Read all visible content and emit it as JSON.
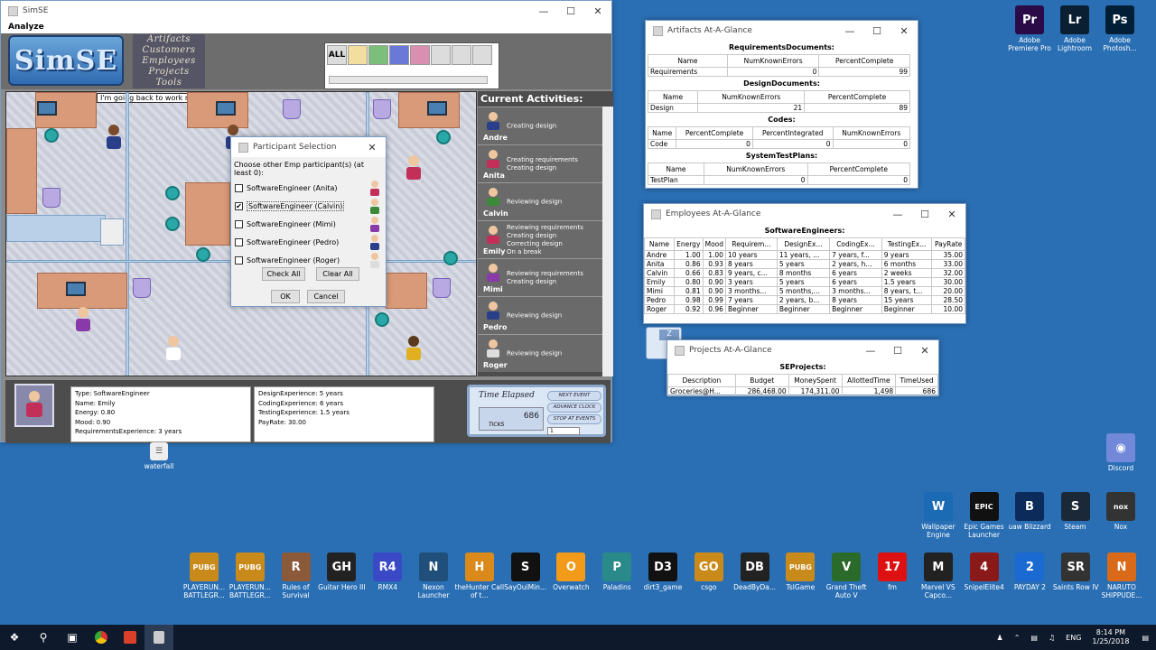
{
  "simse_window": {
    "title": "SimSE",
    "menu": "Analyze",
    "logo": "SimSE",
    "top_menu": [
      "Artifacts",
      "Customers",
      "Employees",
      "Projects",
      "Tools"
    ],
    "palette_all": "ALL",
    "speech_bubble": "I'm going back to work now",
    "activities_title": "Current Activities:",
    "activities": [
      {
        "name": "Andre",
        "lines": [
          "Creating design"
        ]
      },
      {
        "name": "Anita",
        "lines": [
          "Creating requirements",
          "Creating design"
        ]
      },
      {
        "name": "Calvin",
        "lines": [
          "Reviewing design"
        ]
      },
      {
        "name": "Emily",
        "lines": [
          "Reviewing requirements",
          "Creating design",
          "Correcting design",
          "On a break"
        ]
      },
      {
        "name": "Mimi",
        "lines": [
          "Reviewing requirements",
          "Creating design"
        ]
      },
      {
        "name": "Pedro",
        "lines": [
          "Reviewing design"
        ]
      },
      {
        "name": "Roger",
        "lines": [
          "Reviewing design"
        ]
      }
    ],
    "info_left": [
      "Type: SoftwareEngineer",
      "Name: Emily",
      "Energy: 0.80",
      "Mood: 0.90",
      "RequirementsExperience: 3 years"
    ],
    "info_right": [
      "DesignExperience: 5 years",
      "CodingExperience: 6 years",
      "TestingExperience: 1.5 years",
      "PayRate: 30.00"
    ],
    "timer": {
      "label": "Time Elapsed",
      "ticks_value": "686",
      "ticks_label": "TICKS",
      "next_event": "NEXT EVENT",
      "advance_clock": "ADVANCE CLOCK",
      "stop_at_events": "STOP AT EVENTS",
      "field_value": "1"
    }
  },
  "dialog": {
    "title": "Participant Selection",
    "prompt": "Choose other Emp participant(s) (at least 0):",
    "options": [
      {
        "label": "SoftwareEngineer (Anita)",
        "checked": false
      },
      {
        "label": "SoftwareEngineer (Calvin)",
        "checked": true
      },
      {
        "label": "SoftwareEngineer (Mimi)",
        "checked": false
      },
      {
        "label": "SoftwareEngineer (Pedro)",
        "checked": false
      },
      {
        "label": "SoftwareEngineer (Roger)",
        "checked": false
      }
    ],
    "check_all": "Check All",
    "clear_all": "Clear All",
    "ok": "OK",
    "cancel": "Cancel"
  },
  "artifacts_window": {
    "title": "Artifacts At-A-Glance",
    "sections": [
      {
        "title": "RequirementsDocuments:",
        "headers": [
          "Name",
          "NumKnownErrors",
          "PercentComplete"
        ],
        "rows": [
          [
            "Requirements",
            "0",
            "99"
          ]
        ]
      },
      {
        "title": "DesignDocuments:",
        "headers": [
          "Name",
          "NumKnownErrors",
          "PercentComplete"
        ],
        "rows": [
          [
            "Design",
            "21",
            "89"
          ]
        ]
      },
      {
        "title": "Codes:",
        "headers": [
          "Name",
          "PercentComplete",
          "PercentIntegrated",
          "NumKnownErrors"
        ],
        "rows": [
          [
            "Code",
            "0",
            "0",
            "0"
          ]
        ]
      },
      {
        "title": "SystemTestPlans:",
        "headers": [
          "Name",
          "NumKnownErrors",
          "PercentComplete"
        ],
        "rows": [
          [
            "TestPlan",
            "0",
            "0"
          ]
        ]
      }
    ]
  },
  "employees_window": {
    "title": "Employees At-A-Glance",
    "section": "SoftwareEngineers:",
    "headers": [
      "Name",
      "Energy",
      "Mood",
      "Requirem...",
      "DesignEx...",
      "CodingEx...",
      "TestingEx...",
      "PayRate"
    ],
    "rows": [
      [
        "Andre",
        "1.00",
        "1.00",
        "10 years",
        "11 years, ...",
        "7 years, f...",
        "9 years",
        "35.00"
      ],
      [
        "Anita",
        "0.86",
        "0.93",
        "8 years",
        "5 years",
        "2 years, h...",
        "6 months",
        "33.00"
      ],
      [
        "Calvin",
        "0.66",
        "0.83",
        "9 years, c...",
        "8 months",
        "6 years",
        "2 weeks",
        "32.00"
      ],
      [
        "Emily",
        "0.80",
        "0.90",
        "3 years",
        "5 years",
        "6 years",
        "1.5 years",
        "30.00"
      ],
      [
        "Mimi",
        "0.81",
        "0.90",
        "3 months...",
        "5 months,...",
        "3 months...",
        "8 years, t...",
        "20.00"
      ],
      [
        "Pedro",
        "0.98",
        "0.99",
        "7 years",
        "2 years, b...",
        "8 years",
        "15 years",
        "28.50"
      ],
      [
        "Roger",
        "0.92",
        "0.96",
        "Beginner",
        "Beginner",
        "Beginner",
        "Beginner",
        "10.00"
      ]
    ]
  },
  "projects_window": {
    "title": "Projects At-A-Glance",
    "section": "SEProjects:",
    "headers": [
      "Description",
      "Budget",
      "MoneySpent",
      "AllottedTime",
      "TimeUsed"
    ],
    "rows": [
      [
        "Groceries@H...",
        "286,468.00",
        "174,311.00",
        "1,498",
        "686"
      ]
    ]
  },
  "desktop_icons_right_top": [
    {
      "label": "Adobe Premiere Pro",
      "glyph": "Pr",
      "color": "#2a0a47"
    },
    {
      "label": "Adobe Lightroom",
      "glyph": "Lr",
      "color": "#0b1f33"
    },
    {
      "label": "Adobe Photosh...",
      "glyph": "Ps",
      "color": "#001e36"
    }
  ],
  "desktop_waterfall": "waterfall",
  "desktop_discord": "Discord",
  "desktop_icons_right_row": [
    {
      "label": "Wallpaper Engine",
      "glyph": "W",
      "color": "#1a6ab4"
    },
    {
      "label": "Epic Games Launcher",
      "glyph": "EPIC",
      "color": "#111"
    },
    {
      "label": "uaw Blizzard",
      "glyph": "B",
      "color": "#0c2a5a"
    },
    {
      "label": "Steam",
      "glyph": "S",
      "color": "#1b2838"
    },
    {
      "label": "Nox",
      "glyph": "nox",
      "color": "#333"
    }
  ],
  "desktop_icons_bottom": [
    {
      "label": "PLAYERUN... BATTLEGR...",
      "glyph": "PUBG",
      "color": "#c88a1b"
    },
    {
      "label": "PLAYERUN... BATTLEGR...",
      "glyph": "PUBG",
      "color": "#c88a1b"
    },
    {
      "label": "Rules of Survival",
      "glyph": "R",
      "color": "#8a5a3a"
    },
    {
      "label": "Guitar Hero III",
      "glyph": "GH",
      "color": "#222"
    },
    {
      "label": "RMX4",
      "glyph": "R4",
      "color": "#3a4ac7"
    },
    {
      "label": "Nexon Launcher",
      "glyph": "N",
      "color": "#1f4f7a"
    },
    {
      "label": "theHunter Call of t...",
      "glyph": "H",
      "color": "#d98a1a"
    },
    {
      "label": "SayOuiMin...",
      "glyph": "S",
      "color": "#111"
    },
    {
      "label": "Overwatch",
      "glyph": "O",
      "color": "#f29a1a"
    },
    {
      "label": "Paladins",
      "glyph": "P",
      "color": "#2a8a8a"
    },
    {
      "label": "dirt3_game",
      "glyph": "D3",
      "color": "#111"
    },
    {
      "label": "csgo",
      "glyph": "GO",
      "color": "#c98a1a"
    },
    {
      "label": "DeadByDa...",
      "glyph": "DB",
      "color": "#222"
    },
    {
      "label": "TslGame",
      "glyph": "PUBG",
      "color": "#c88a1b"
    },
    {
      "label": "Grand Theft Auto V",
      "glyph": "V",
      "color": "#2a6a2a"
    },
    {
      "label": "fm",
      "glyph": "17",
      "color": "#d11"
    },
    {
      "label": "Marvel VS Capco...",
      "glyph": "M",
      "color": "#222"
    },
    {
      "label": "SnipelElite4",
      "glyph": "4",
      "color": "#8a1a1a"
    },
    {
      "label": "PAYDAY 2",
      "glyph": "2",
      "color": "#1a6ad1"
    },
    {
      "label": "Saints Row IV",
      "glyph": "SR",
      "color": "#333"
    },
    {
      "label": "NARUTO SHIPPUDE...",
      "glyph": "N",
      "color": "#d96a1a"
    }
  ],
  "taskbar": {
    "tray_lang": "ENG",
    "time": "8:14 PM",
    "date": "1/25/2018"
  },
  "z_badge": "Z"
}
